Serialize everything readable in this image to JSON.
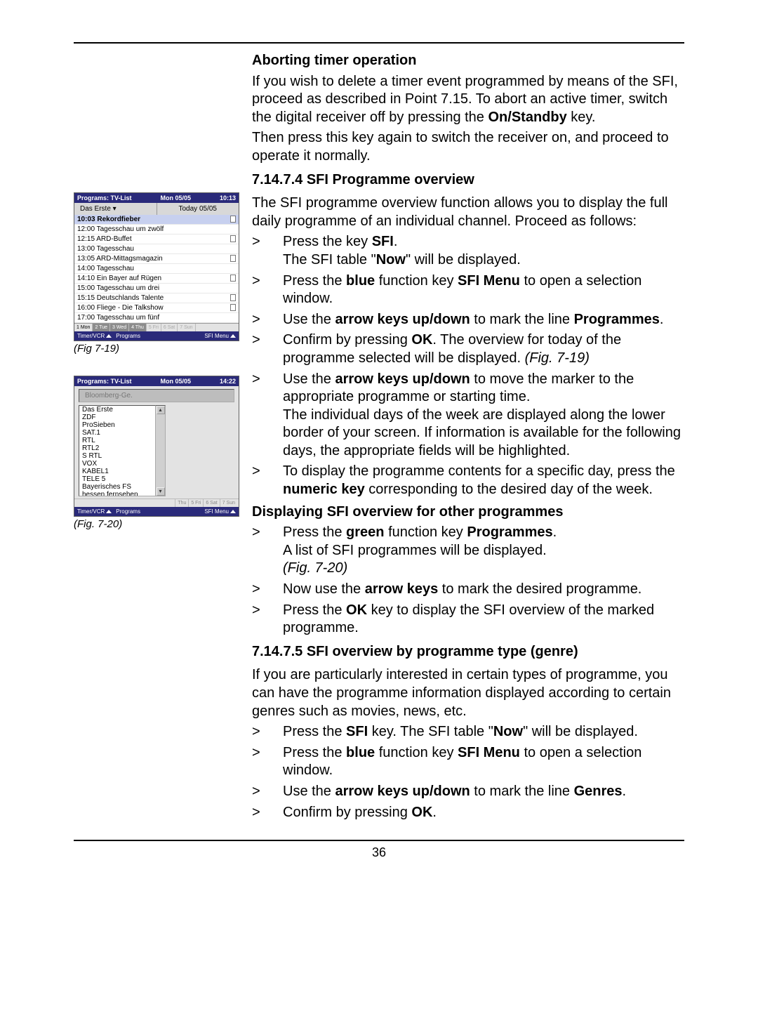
{
  "page_number": "36",
  "fig19_caption": "(Fig 7-19)",
  "fig20_caption": "(Fig. 7-20)",
  "fig19": {
    "title_left": "Programs: TV-List",
    "title_mid": "Mon 05/05",
    "title_right": "10:13",
    "channel": "Das Erste ▾",
    "today": "Today 05/05",
    "rows": [
      {
        "t": "10:03 Rekordfieber",
        "i": true,
        "sel": true
      },
      {
        "t": "12:00 Tagesschau um zwölf",
        "i": false
      },
      {
        "t": "12:15 ARD-Buffet",
        "i": true
      },
      {
        "t": "13:00 Tagesschau",
        "i": false
      },
      {
        "t": "13:05 ARD-Mittagsmagazin",
        "i": true
      },
      {
        "t": "14:00 Tagesschau",
        "i": false
      },
      {
        "t": "14:10 Ein Bayer auf Rügen",
        "i": true
      },
      {
        "t": "15:00 Tagesschau um drei",
        "i": false
      },
      {
        "t": "15:15 Deutschlands Talente",
        "i": true
      },
      {
        "t": "16:00 Fliege - Die Talkshow",
        "i": true
      },
      {
        "t": "17:00 Tagesschau um fünf",
        "i": false
      }
    ],
    "days": [
      "1 Mon",
      "2 Tue",
      "3 Wed",
      "4 Thu",
      "5 Fri",
      "6 Sat",
      "7 Sun"
    ],
    "foot_left": "Timer/VCR",
    "foot_mid": "Programs",
    "foot_right": "SFI Menu"
  },
  "fig20": {
    "title_left": "Programs: TV-List",
    "title_mid": "Mon 05/05",
    "title_right": "14:22",
    "selected": "Bloomberg-Ge.",
    "channels": [
      "Das Erste",
      "ZDF",
      "ProSieben",
      "SAT.1",
      "RTL",
      "RTL2",
      "S RTL",
      "VOX",
      "KABEL1",
      "TELE 5",
      "Bayerisches FS",
      "hessen fernsehen"
    ],
    "days": [
      "Thu",
      "5 Fri",
      "6 Sat",
      "7 Sun"
    ],
    "foot_left": "Timer/VCR",
    "foot_mid": "Programs",
    "foot_right": "SFI Menu"
  },
  "text": {
    "abort_h": "Aborting timer operation",
    "abort_p1": "If you wish to delete a timer event programmed by means of the SFI, proceed as described in Point 7.15. To abort an active timer, switch the digital receiver off by pressing the ",
    "abort_b1": "On/Standby",
    "abort_p1b": " key.",
    "abort_p2": "Then press this key again to switch the receiver on, and proceed to operate it normally.",
    "h7_14_7_4": "7.14.7.4 SFI Programme overview",
    "ov_p1": "The SFI programme overview function allows you to display the full daily programme of an individual channel. Proceed as follows:",
    "ov_b1a": "Press the key ",
    "ov_b1b": "SFI",
    "ov_b1c": ".",
    "ov_b1d": "The SFI table \"",
    "ov_b1e": "Now",
    "ov_b1f": "\" will be displayed.",
    "ov_b2a": "Press the ",
    "ov_b2b": "blue",
    "ov_b2c": " function key ",
    "ov_b2d": "SFI Menu",
    "ov_b2e": " to open a selection window.",
    "ov_b3a": "Use the ",
    "ov_b3b": "arrow keys up/down",
    "ov_b3c": " to mark the line ",
    "ov_b3d": "Programmes",
    "ov_b3e": ".",
    "ov_b4a": "Confirm by pressing ",
    "ov_b4b": "OK",
    "ov_b4c": ". The overview for today of the programme selected will be displayed. ",
    "ov_b4d": "(Fig. 7-19)",
    "ov_b5a": "Use the ",
    "ov_b5b": "arrow keys up/down",
    "ov_b5c": " to move the marker to the appropriate programme or starting time.",
    "ov_b5d": "The individual days of the week are displayed along the lower border of your screen. If information is available for the following days, the appropriate fields will be highlighted.",
    "ov_b6a": "To display the programme contents for a specific day, press the ",
    "ov_b6b": "numeric key",
    "ov_b6c": " corresponding to the desired day of the week.",
    "disp_h": "Displaying SFI overview for other programmes",
    "dp_b1a": "Press the ",
    "dp_b1b": "green",
    "dp_b1c": " function key ",
    "dp_b1d": "Programmes",
    "dp_b1e": ".",
    "dp_b1f": "A list of SFI programmes will be displayed.",
    "dp_b1g": "(Fig. 7-20)",
    "dp_b2a": "Now use the ",
    "dp_b2b": "arrow keys",
    "dp_b2c": " to mark the desired programme.",
    "dp_b3a": "Press the ",
    "dp_b3b": "OK",
    "dp_b3c": " key to display the SFI overview of the marked programme.",
    "h7_14_7_5": "7.14.7.5 SFI overview by programme type (genre)",
    "gn_p1": "If you are particularly interested in certain types of programme, you can have the programme information displayed according to certain genres such as movies, news, etc.",
    "gn_b1a": "Press the ",
    "gn_b1b": "SFI",
    "gn_b1c": " key. The SFI table \"",
    "gn_b1d": "Now",
    "gn_b1e": "\" will be displayed.",
    "gn_b2a": "Press the ",
    "gn_b2b": "blue",
    "gn_b2c": " function key ",
    "gn_b2d": "SFI Menu",
    "gn_b2e": " to open a selection window.",
    "gn_b3a": "Use the ",
    "gn_b3b": "arrow keys up/down",
    "gn_b3c": " to mark the line ",
    "gn_b3d": "Genres",
    "gn_b3e": ".",
    "gn_b4a": "Confirm by pressing ",
    "gn_b4b": "OK",
    "gn_b4c": "."
  }
}
